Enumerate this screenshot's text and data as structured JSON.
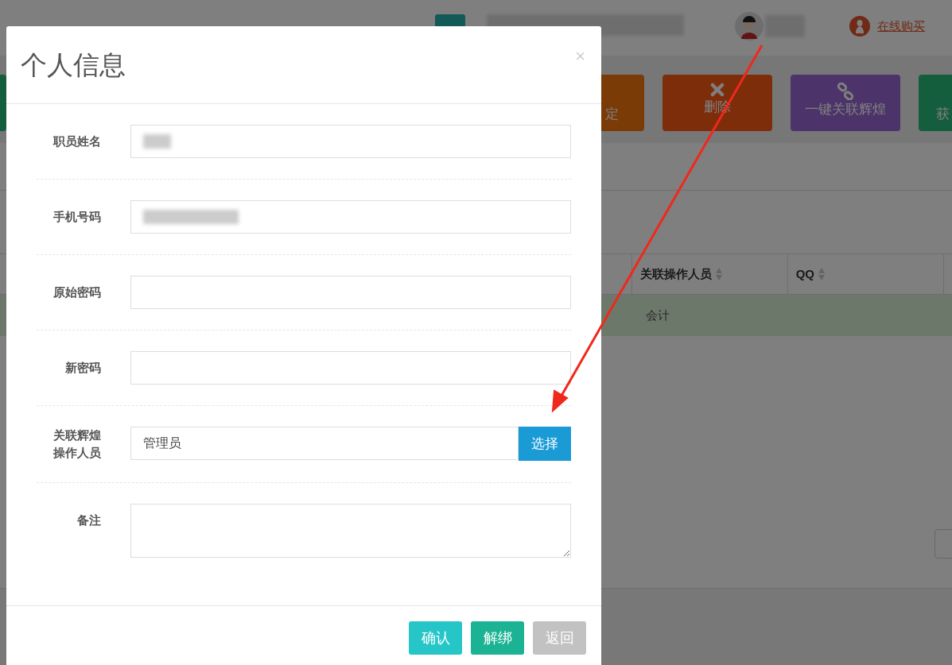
{
  "header": {
    "buy_link": "在线购买"
  },
  "toolbar": {
    "buttons": [
      {
        "label": "定",
        "kind": "lock"
      },
      {
        "label": "删除",
        "kind": "delete"
      },
      {
        "label": "一键关联辉煌",
        "kind": "link"
      },
      {
        "label": "获",
        "kind": "fetch"
      }
    ]
  },
  "table": {
    "columns": [
      "关联操作人员",
      "QQ"
    ],
    "rows": [
      {
        "operator": "会计",
        "selected": true
      }
    ]
  },
  "modal": {
    "title": "个人信息",
    "close": "×",
    "fields": [
      {
        "label": "职员姓名",
        "kind": "redacted"
      },
      {
        "label": "手机号码",
        "kind": "redacted"
      },
      {
        "label": "原始密码",
        "kind": "text"
      },
      {
        "label": "新密码",
        "kind": "text"
      },
      {
        "label": "关联辉煌操作人员",
        "kind": "select",
        "value": "管理员",
        "button": "选择"
      },
      {
        "label": "备注",
        "kind": "textarea"
      }
    ],
    "buttons": [
      {
        "label": "确认",
        "disabled": false
      },
      {
        "label": "解绑",
        "disabled": false
      },
      {
        "label": "返回",
        "disabled": true
      }
    ]
  }
}
